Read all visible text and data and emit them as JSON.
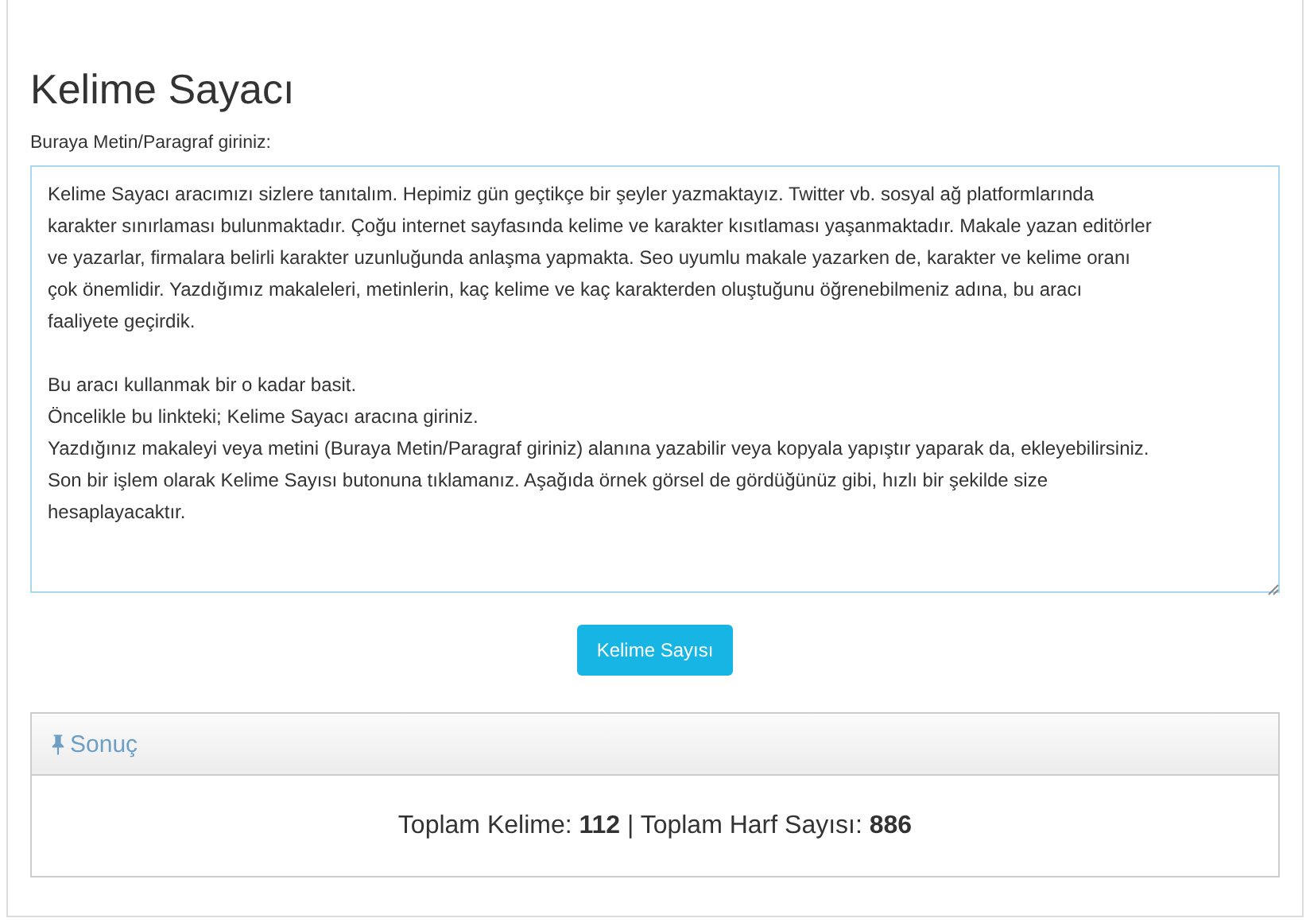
{
  "title": "Kelime Sayacı",
  "input": {
    "label": "Buraya Metin/Paragraf giriniz:",
    "value": "Kelime Sayacı aracımızı sizlere tanıtalım. Hepimiz gün geçtikçe bir şeyler yazmaktayız. Twitter vb. sosyal ağ platformlarında\nkarakter sınırlaması bulunmaktadır. Çoğu internet sayfasında kelime ve karakter kısıtlaması yaşanmaktadır. Makale yazan editörler\nve yazarlar, firmalara belirli karakter uzunluğunda anlaşma yapmakta. Seo uyumlu makale yazarken de, karakter ve kelime oranı\nçok önemlidir. Yazdığımız makaleleri, metinlerin, kaç kelime ve kaç karakterden oluştuğunu öğrenebilmeniz adına, bu aracı\nfaaliyete geçirdik.\n\nBu aracı kullanmak bir o kadar basit.\nÖncelikle bu linkteki; Kelime Sayacı aracına giriniz.\nYazdığınız makaleyi veya metini (Buraya Metin/Paragraf giriniz) alanına yazabilir veya kopyala yapıştır yaparak da, ekleyebilirsiniz.\nSon bir işlem olarak Kelime Sayısı butonuna tıklamanız. Aşağıda örnek görsel de gördüğünüz gibi, hızlı bir şekilde size\nhesaplayacaktır."
  },
  "button": "Kelime Sayısı",
  "result_panel": {
    "heading": "Sonuç",
    "text": "Toplam Kelime: **112** | Toplam Harf Sayısı: **886**"
  }
}
